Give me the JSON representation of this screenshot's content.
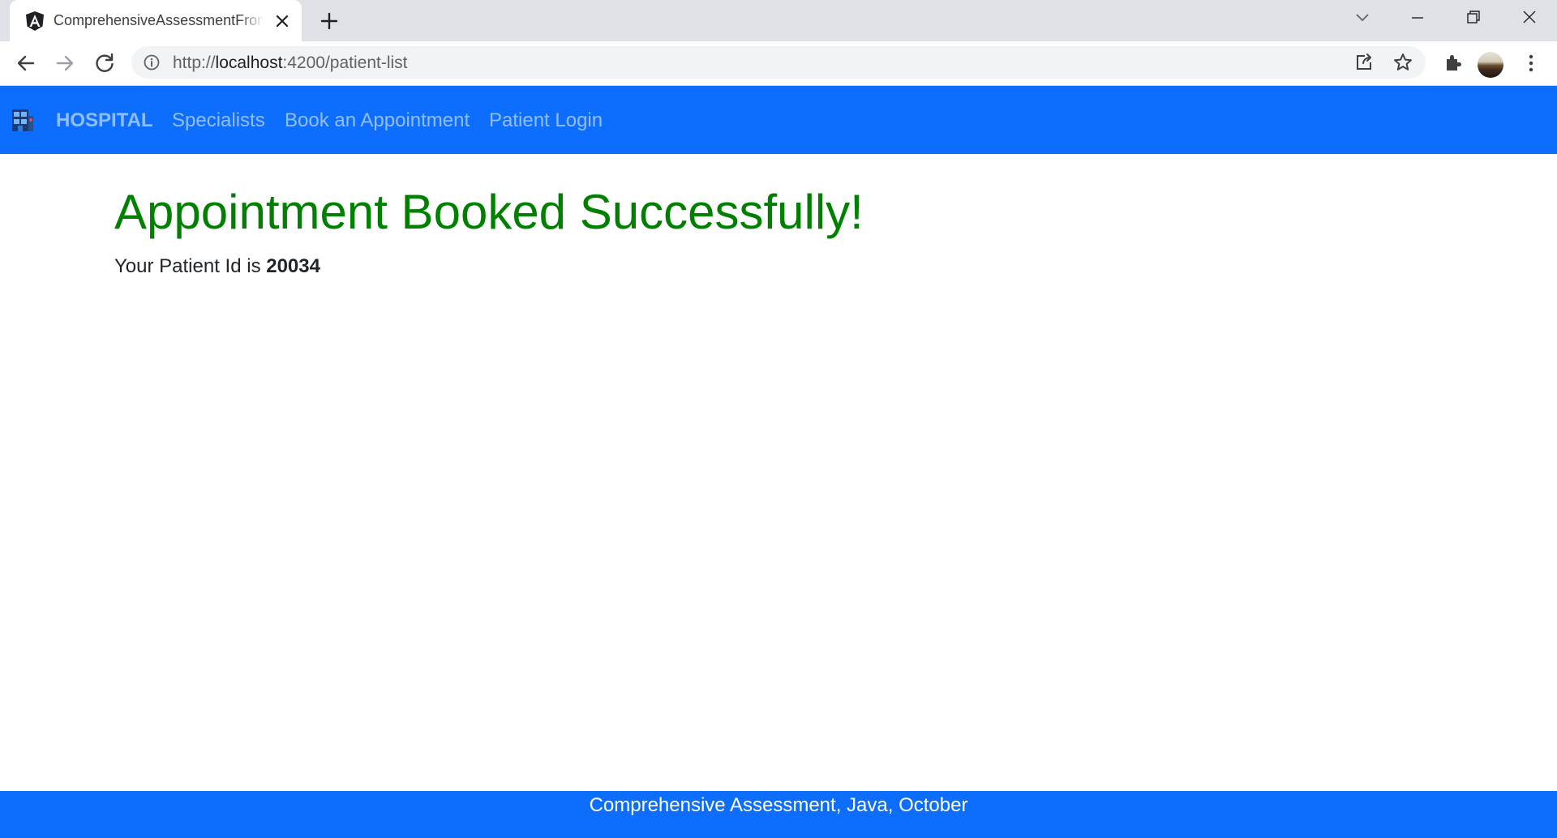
{
  "browser": {
    "tab": {
      "title": "ComprehensiveAssessmentFrontend",
      "favicon": "angular-icon"
    },
    "address_bar": {
      "scheme": "http://",
      "host": "localhost",
      "rest": ":4200/patient-list"
    },
    "toolbar_icons": [
      "back-icon",
      "forward-icon",
      "reload-icon",
      "share-icon",
      "star-icon",
      "extensions-icon",
      "profile-avatar",
      "menu-icon"
    ],
    "window_icons": [
      "tab-search-icon",
      "minimize-icon",
      "restore-icon",
      "close-icon"
    ]
  },
  "navbar": {
    "brand": "HOSPITAL",
    "links": [
      "Specialists",
      "Book an Appointment",
      "Patient Login"
    ],
    "color": "#0d6efd"
  },
  "main": {
    "title": "Appointment Booked Successfully!",
    "title_color": "#008000",
    "patient_prefix": "Your Patient Id is",
    "patient_id": "20034"
  },
  "footer": {
    "text": "Comprehensive Assessment, Java, October"
  }
}
